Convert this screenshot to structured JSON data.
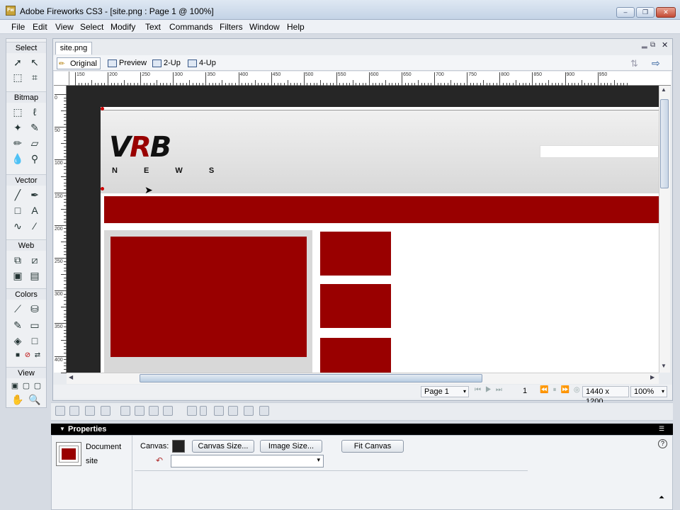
{
  "window": {
    "title": "Adobe Fireworks CS3 - [site.png : Page 1 @ 100%]",
    "app_icon": "Fw",
    "buttons": {
      "minimize": "–",
      "restore": "❐",
      "close": "✕"
    }
  },
  "menu": [
    "File",
    "Edit",
    "View",
    "Select",
    "Modify",
    "Text",
    "Commands",
    "Filters",
    "Window",
    "Help"
  ],
  "tools": {
    "sections": [
      "Select",
      "Bitmap",
      "Vector",
      "Web",
      "Colors",
      "View"
    ]
  },
  "document": {
    "tab": "site.png",
    "view_modes": [
      "Original",
      "Preview",
      "2-Up",
      "4-Up"
    ],
    "ruler_top": [
      "150",
      "200",
      "250",
      "300",
      "350",
      "400",
      "450",
      "500",
      "550",
      "600",
      "650",
      "700",
      "750",
      "800",
      "850",
      "900",
      "950"
    ],
    "ruler_left": [
      "0",
      "50",
      "100",
      "150",
      "200",
      "250",
      "300",
      "350",
      "400"
    ],
    "canvas": {
      "logo_main": "VRB",
      "logo_sub": "N E W S"
    },
    "status": {
      "page": "Page 1",
      "page_number": "1",
      "dimensions": "1440 x 1200",
      "zoom": "100%"
    }
  },
  "properties": {
    "header": "Properties",
    "doc_type": "Document",
    "doc_name": "site",
    "canvas_label": "Canvas:",
    "buttons": [
      "Canvas Size...",
      "Image Size...",
      "Fit Canvas"
    ],
    "help": "?"
  },
  "colors": {
    "accent": "#990000",
    "pasteboard": "#262626"
  }
}
